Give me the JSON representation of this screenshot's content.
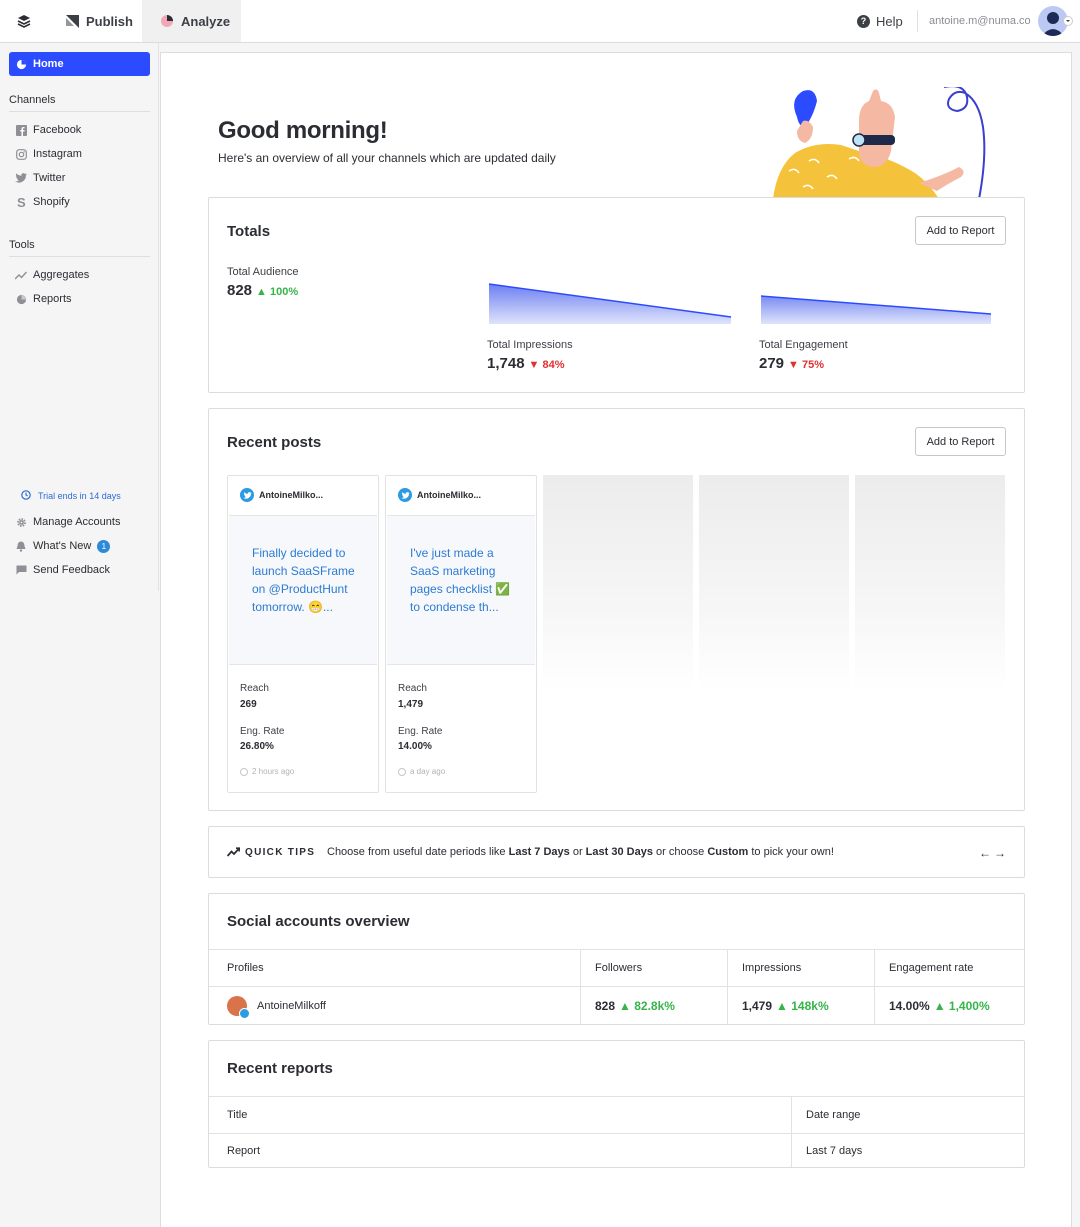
{
  "topbar": {
    "publish_label": "Publish",
    "analyze_label": "Analyze",
    "help_label": "Help",
    "user_email": "antoine.m@numa.co"
  },
  "sidebar": {
    "home_label": "Home",
    "channels_heading": "Channels",
    "channels": [
      {
        "label": "Facebook",
        "icon": "facebook-icon"
      },
      {
        "label": "Instagram",
        "icon": "instagram-icon"
      },
      {
        "label": "Twitter",
        "icon": "twitter-icon"
      },
      {
        "label": "Shopify",
        "icon": "shopify-icon"
      }
    ],
    "tools_heading": "Tools",
    "tools": [
      {
        "label": "Aggregates",
        "icon": "trend-icon"
      },
      {
        "label": "Reports",
        "icon": "pie-icon"
      }
    ],
    "trial_text": "Trial ends in 14 days",
    "manage_accounts": "Manage Accounts",
    "whats_new": "What's New",
    "whats_new_count": "1",
    "send_feedback": "Send Feedback"
  },
  "main": {
    "greeting": "Good morning!",
    "subtitle": "Here's an overview of all your channels which are updated daily"
  },
  "totals": {
    "title": "Totals",
    "add_label": "Add to Report",
    "audience_label": "Total Audience",
    "audience_value": "828",
    "audience_change": "▲ 100%",
    "impressions_label": "Total Impressions",
    "impressions_value": "1,748",
    "impressions_change": "▼ 84%",
    "engagement_label": "Total Engagement",
    "engagement_value": "279",
    "engagement_change": "▼ 75%"
  },
  "recent_posts": {
    "title": "Recent posts",
    "add_label": "Add to Report",
    "posts": [
      {
        "author": "AntoineMilko...",
        "text": "Finally decided to launch SaaSFrame on @ProductHunt tomorrow. 😁...",
        "reach_label": "Reach",
        "reach": "269",
        "eng_label": "Eng. Rate",
        "eng_rate": "26.80%",
        "time": "2 hours ago"
      },
      {
        "author": "AntoineMilko...",
        "text": "I've just made a SaaS marketing pages checklist ✅ to condense th...",
        "reach_label": "Reach",
        "reach": "1,479",
        "eng_label": "Eng. Rate",
        "eng_rate": "14.00%",
        "time": "a day ago"
      }
    ]
  },
  "quick_tips": {
    "title": "QUICK TIPS",
    "text_1": "Choose from useful date periods like ",
    "bold_1": "Last 7 Days",
    "text_2": " or ",
    "bold_2": "Last 30 Days",
    "text_3": " or choose ",
    "bold_3": "Custom",
    "text_4": " to pick your own!",
    "prev": "←",
    "next": "→"
  },
  "social_overview": {
    "title": "Social accounts overview",
    "columns": [
      "Profiles",
      "Followers",
      "Impressions",
      "Engagement rate"
    ],
    "row": {
      "profile": "AntoineMilkoff",
      "followers": "828",
      "followers_change": "▲ 82.8k%",
      "impressions": "1,479",
      "impressions_change": "▲ 148k%",
      "engagement": "14.00%",
      "engagement_change": "▲ 1,400%"
    }
  },
  "recent_reports": {
    "title": "Recent reports",
    "columns": [
      "Title",
      "Date range"
    ],
    "row": {
      "title": "Report",
      "date_range": "Last 7 days"
    }
  },
  "colors": {
    "primary": "#2c4bff",
    "positive": "#36b44a",
    "negative": "#e0302f",
    "twitter": "#2d9be3",
    "illustration_yellow": "#f5c33b"
  }
}
